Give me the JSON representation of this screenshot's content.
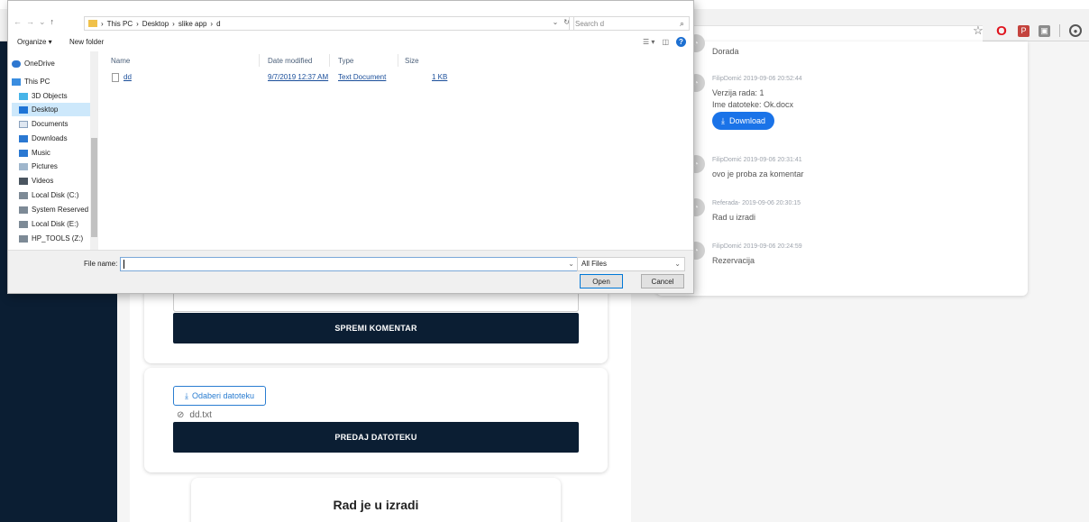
{
  "dialog": {
    "title": "",
    "nav_arrows": [
      "←",
      "→",
      "⌄",
      "↑"
    ],
    "address": [
      "This PC",
      "Desktop",
      "slike app",
      "d"
    ],
    "search_placeholder": "Search d",
    "organize_label": "Organize ▾",
    "new_folder_label": "New folder",
    "nav_items": [
      {
        "label": "OneDrive",
        "icon": "cloud-icon"
      },
      {
        "label": "This PC",
        "icon": "computer-icon"
      },
      {
        "label": "3D Objects",
        "icon": "cube-icon"
      },
      {
        "label": "Desktop",
        "icon": "desktop-icon"
      },
      {
        "label": "Documents",
        "icon": "documents-icon"
      },
      {
        "label": "Downloads",
        "icon": "download-icon"
      },
      {
        "label": "Music",
        "icon": "music-icon"
      },
      {
        "label": "Pictures",
        "icon": "pictures-icon"
      },
      {
        "label": "Videos",
        "icon": "videos-icon"
      },
      {
        "label": "Local Disk (C:)",
        "icon": "drive-icon"
      },
      {
        "label": "System Reserved",
        "icon": "drive-icon"
      },
      {
        "label": "Local Disk (E:)",
        "icon": "drive-icon"
      },
      {
        "label": "HP_TOOLS (Z:)",
        "icon": "drive-icon"
      }
    ],
    "columns": [
      "Name",
      "Date modified",
      "Type",
      "Size"
    ],
    "files": [
      {
        "name": "dd",
        "date": "9/7/2019 12:37 AM",
        "type": "Text Document",
        "size": "1 KB"
      }
    ],
    "file_name_label": "File name:",
    "file_name_value": "",
    "file_type": "All Files",
    "open_label": "Open",
    "cancel_label": "Cancel"
  },
  "comment_card": {
    "save_label": "SPREMI KOMENTAR"
  },
  "upload_card": {
    "choose_label": "Odaberi datoteku",
    "file_name": "dd.txt",
    "submit_label": "PREDAJ DATOTEKU"
  },
  "status_card": {
    "title": "Rad je u izradi"
  },
  "history": [
    {
      "meta": "",
      "text": "Dorada"
    },
    {
      "meta": "FilipDomić  2019-09-06 20:52:44",
      "version": "Verzija rada: 1",
      "file": "Ime datoteke: Ok.docx",
      "download": "Download"
    },
    {
      "meta": "FilipDomić  2019-09-06 20:31:41",
      "text": "ovo je proba za komentar"
    },
    {
      "meta": "Referada-  2019-09-06 20:30:15",
      "text": "Rad u izradi"
    },
    {
      "meta": "FilipDomić  2019-09-06 20:24:59",
      "text": "Rezervacija"
    }
  ],
  "colors": {
    "navy": "#0b1e33",
    "accent_blue": "#1a73e8",
    "link_blue": "#2a7dd1"
  }
}
